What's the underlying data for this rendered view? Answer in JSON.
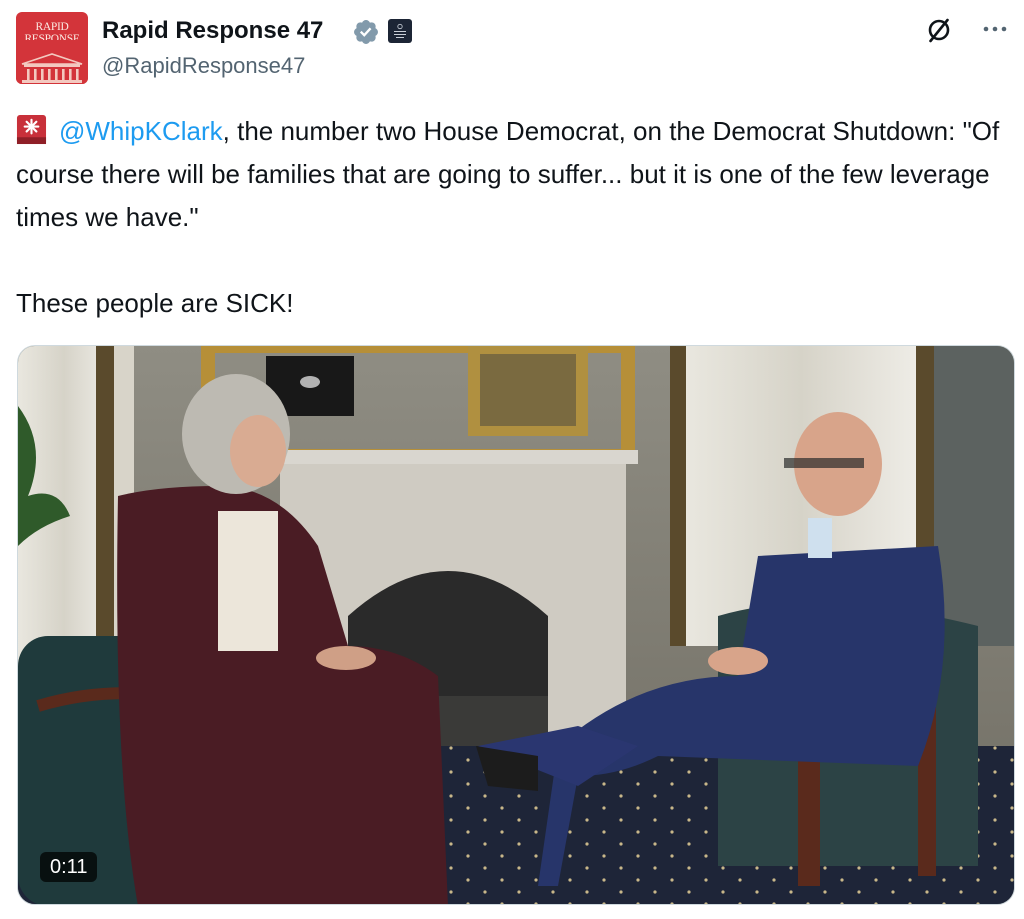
{
  "author": {
    "display_name": "Rapid Response 47",
    "handle": "@RapidResponse47",
    "avatar_logo_line1": "RAPID",
    "avatar_logo_line2": "RESPONSE",
    "verified": true,
    "verified_color": "#829aab",
    "affiliate_badge": "government-seal-icon"
  },
  "actions": {
    "grok_icon": "grok-slash-circle-icon",
    "more_icon": "more-horizontal-icon"
  },
  "tweet": {
    "emoji": "police-siren-emoji",
    "mention": "@WhipKClark",
    "text_after_mention": ", the number two House Democrat, on the Democrat Shutdown: \"Of course there will be families that are going to suffer... but it is one of the few leverage times we have.\"",
    "text_paragraph2": "These people are SICK!"
  },
  "media": {
    "type": "video",
    "duration": "0:11",
    "description_icon": "video-thumbnail-interview"
  },
  "colors": {
    "text": "#0f1419",
    "secondary": "#536471",
    "link": "#1d9bf0",
    "avatar_bg": "#d3343a"
  }
}
